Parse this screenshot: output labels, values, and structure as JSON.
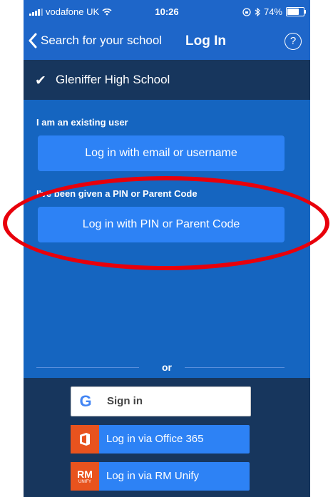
{
  "status_bar": {
    "carrier": "vodafone UK",
    "time": "10:26",
    "battery": "74%",
    "battery_level": 0.74
  },
  "nav": {
    "back_label": "Search for your school",
    "title": "Log In",
    "help_icon": "?"
  },
  "school": {
    "name": "Gleniffer High School"
  },
  "existing_user": {
    "label": "I am an existing user",
    "button": "Log in with email or username"
  },
  "pin": {
    "label": "I've been given a PIN or Parent Code",
    "button": "Log in with PIN or Parent Code"
  },
  "divider_text": "or",
  "sso": {
    "google": {
      "icon_letter": "G",
      "label": "Sign in"
    },
    "office": {
      "label": "Log in via Office 365"
    },
    "rm": {
      "icon_top": "RM",
      "icon_bottom": "UNIFY",
      "label": "Log in via RM Unify"
    }
  },
  "colors": {
    "primary": "#1565c0",
    "button": "#2d82f5",
    "dark": "#17365d",
    "office_orange": "#e8531e",
    "annotation_red": "#e8000b"
  }
}
